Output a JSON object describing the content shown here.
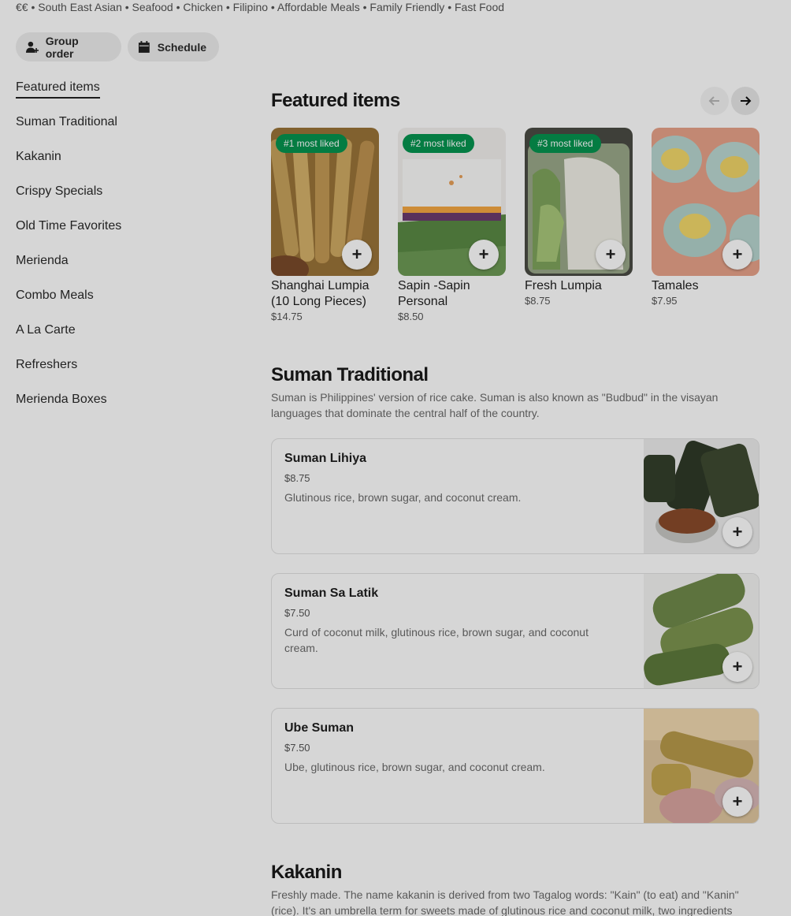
{
  "tags_line": "€€ • South East Asian • Seafood • Chicken • Filipino • Affordable Meals • Family Friendly • Fast Food",
  "actions": {
    "group_order": "Group order",
    "schedule": "Schedule"
  },
  "sidebar": {
    "items": [
      {
        "label": "Featured items",
        "active": true
      },
      {
        "label": "Suman Traditional"
      },
      {
        "label": "Kakanin"
      },
      {
        "label": "Crispy Specials"
      },
      {
        "label": "Old Time Favorites"
      },
      {
        "label": "Merienda"
      },
      {
        "label": "Combo Meals"
      },
      {
        "label": "A La Carte"
      },
      {
        "label": "Refreshers"
      },
      {
        "label": "Merienda Boxes"
      }
    ]
  },
  "featured": {
    "title": "Featured items",
    "items": [
      {
        "badge": "#1 most liked",
        "name": "Shanghai Lumpia (10 Long Pieces)",
        "price": "$14.75"
      },
      {
        "badge": "#2 most liked",
        "name": "Sapin -Sapin Personal",
        "price": "$8.50"
      },
      {
        "badge": "#3 most liked",
        "name": "Fresh Lumpia",
        "price": "$8.75"
      },
      {
        "badge": "",
        "name": "Tamales",
        "price": "$7.95"
      }
    ]
  },
  "suman": {
    "title": "Suman Traditional",
    "description": "Suman is Philippines' version of rice cake. Suman is also known as \"Budbud\" in the visayan languages that dominate the central half of the country.",
    "items": [
      {
        "name": "Suman Lihiya",
        "price": "$8.75",
        "description": "Glutinous rice, brown sugar, and coconut cream."
      },
      {
        "name": "Suman Sa Latik",
        "price": "$7.50",
        "description": "Curd of coconut milk, glutinous rice, brown sugar, and coconut cream."
      },
      {
        "name": "Ube Suman",
        "price": "$7.50",
        "description": "Ube, glutinous rice, brown sugar, and coconut cream."
      }
    ]
  },
  "kakanin": {
    "title": "Kakanin",
    "description": "Freshly made. The name kakanin is derived from two Tagalog words: \"Kain\" (to eat) and \"Kanin\" (rice). It's an umbrella term for sweets made of glutinous rice and coconut milk, two ingredients"
  },
  "icons": {
    "plus": "+",
    "add_icon": "plus-icon",
    "group_icon": "add-person-icon",
    "schedule_icon": "calendar-icon"
  },
  "colors": {
    "badge_green": "#05944f",
    "overlay": "rgba(0,0,0,0.16)"
  }
}
